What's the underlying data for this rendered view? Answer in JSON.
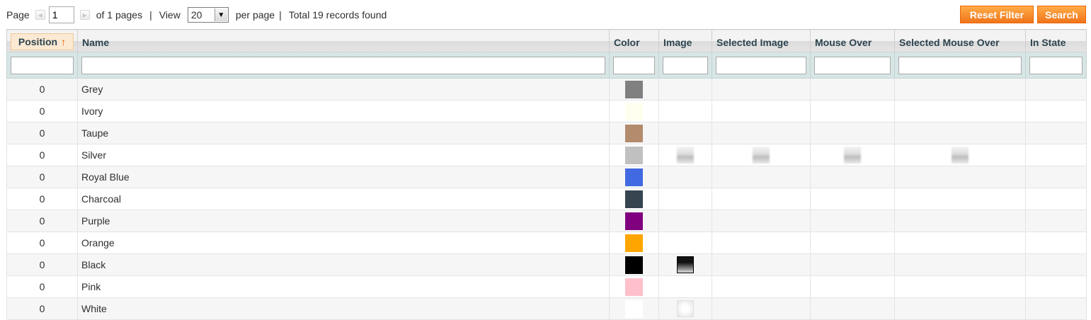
{
  "pager": {
    "page_label": "Page",
    "page_value": "1",
    "of_pages": "of 1 pages",
    "view_label": "View",
    "per_page_value": "20",
    "per_page_label": "per page",
    "separator": "|",
    "total": "Total 19 records found"
  },
  "actions": {
    "reset_filter": "Reset Filter",
    "search": "Search"
  },
  "columns": {
    "position": "Position",
    "name": "Name",
    "color": "Color",
    "image": "Image",
    "selected_image": "Selected Image",
    "mouse_over": "Mouse Over",
    "selected_mouse_over": "Selected Mouse Over",
    "in_state": "In State"
  },
  "sort_indicator": "↑",
  "rows": [
    {
      "position": "0",
      "name": "Grey",
      "color": "#808080",
      "image": "",
      "selected_image": "",
      "mouse_over": "",
      "selected_mouse_over": ""
    },
    {
      "position": "0",
      "name": "Ivory",
      "color": "#fffff0",
      "image": "",
      "selected_image": "",
      "mouse_over": "",
      "selected_mouse_over": ""
    },
    {
      "position": "0",
      "name": "Taupe",
      "color": "#b38b6d",
      "image": "",
      "selected_image": "",
      "mouse_over": "",
      "selected_mouse_over": ""
    },
    {
      "position": "0",
      "name": "Silver",
      "color": "#c0c0c0",
      "image": "silver-swatch-image",
      "selected_image": "silver-swatch-image",
      "mouse_over": "silver-swatch-image",
      "selected_mouse_over": "silver-swatch-image"
    },
    {
      "position": "0",
      "name": "Royal Blue",
      "color": "#4169e1",
      "image": "",
      "selected_image": "",
      "mouse_over": "",
      "selected_mouse_over": ""
    },
    {
      "position": "0",
      "name": "Charcoal",
      "color": "#36454f",
      "image": "",
      "selected_image": "",
      "mouse_over": "",
      "selected_mouse_over": ""
    },
    {
      "position": "0",
      "name": "Purple",
      "color": "#800080",
      "image": "",
      "selected_image": "",
      "mouse_over": "",
      "selected_mouse_over": ""
    },
    {
      "position": "0",
      "name": "Orange",
      "color": "#ffa500",
      "image": "",
      "selected_image": "",
      "mouse_over": "",
      "selected_mouse_over": ""
    },
    {
      "position": "0",
      "name": "Black",
      "color": "#000000",
      "image": "black-swatch-image",
      "selected_image": "",
      "mouse_over": "",
      "selected_mouse_over": ""
    },
    {
      "position": "0",
      "name": "Pink",
      "color": "#ffc0cb",
      "image": "",
      "selected_image": "",
      "mouse_over": "",
      "selected_mouse_over": ""
    },
    {
      "position": "0",
      "name": "White",
      "color": "#ffffff",
      "image": "white-swatch-image",
      "selected_image": "",
      "mouse_over": "",
      "selected_mouse_over": ""
    }
  ],
  "colors": {
    "button_orange": "#f0741b",
    "filter_row": "#d7e5e5",
    "header_text": "#2d444f",
    "sorted_header": "#fbe9d3"
  }
}
